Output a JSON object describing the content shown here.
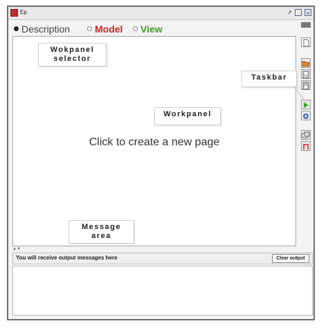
{
  "window": {
    "title": "Ep"
  },
  "selector": {
    "options": [
      {
        "label": "Description",
        "selected": true,
        "color": "#444444"
      },
      {
        "label": "Model",
        "selected": false,
        "color": "#c4201c"
      },
      {
        "label": "View",
        "selected": false,
        "color": "#3f9a24"
      }
    ]
  },
  "workpanel": {
    "hint": "Click to create a new page"
  },
  "callouts": {
    "selector": [
      "Wokpanel",
      "selector"
    ],
    "taskbar": "Taskbar",
    "workpanel": "Workpanel",
    "message": [
      "Message",
      "area"
    ]
  },
  "taskbar": {
    "buttons": [
      {
        "icon": "new-page-icon"
      },
      {
        "icon": "open-folder-icon"
      },
      {
        "icon": "save-icon"
      },
      {
        "icon": "save-as-icon"
      },
      {
        "icon": "run-icon",
        "color": "#3aa524"
      },
      {
        "icon": "debug-icon"
      },
      {
        "icon": "window-icon"
      },
      {
        "icon": "export-icon",
        "color": "#c4201c"
      }
    ]
  },
  "messages": {
    "hint": "You will receive output messages here",
    "clear_label": "Clear output"
  }
}
